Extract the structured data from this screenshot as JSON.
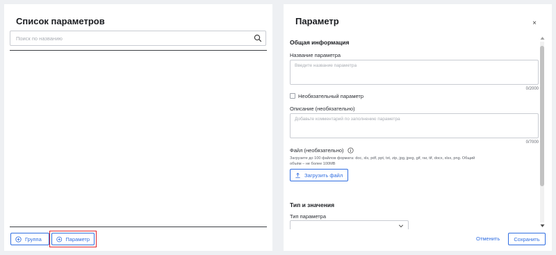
{
  "left_panel": {
    "title": "Список параметров",
    "search": {
      "placeholder": "Поиск по названию"
    },
    "buttons": {
      "group": "Группа",
      "parameter": "Параметр"
    }
  },
  "right_panel": {
    "title": "Параметр",
    "close_glyph": "×",
    "general_section": "Общая информация",
    "name_label": "Название параметра",
    "name_placeholder": "Введите название параметра",
    "name_counter": "0/2000",
    "optional_label": "Необязательный параметр",
    "description_label": "Описание (необязательно)",
    "description_placeholder": "Добавьте комментарий по заполнению параметра",
    "description_counter": "0/7000",
    "file_label": "Файл (необязательно)",
    "file_hint": "Загрузите до 100 файлов формата: doc, xls, pdf, ppt, txt, zip, jpg, jpeg, gif, rar, tif, docx, xlsx, png. Общий объём – не более 100МВ",
    "upload_button": "Загрузить файл",
    "type_section": "Тип и значения",
    "type_label": "Тип параметра",
    "type_value": "",
    "cancel": "Отменить",
    "save": "Сохранить"
  },
  "colors": {
    "accent": "#2f6de1",
    "highlight": "#e0242c",
    "background": "#eef0f3"
  },
  "icons": [
    "search-icon",
    "plus-circle-icon",
    "close-icon",
    "info-icon",
    "upload-icon",
    "chevron-down-icon"
  ]
}
